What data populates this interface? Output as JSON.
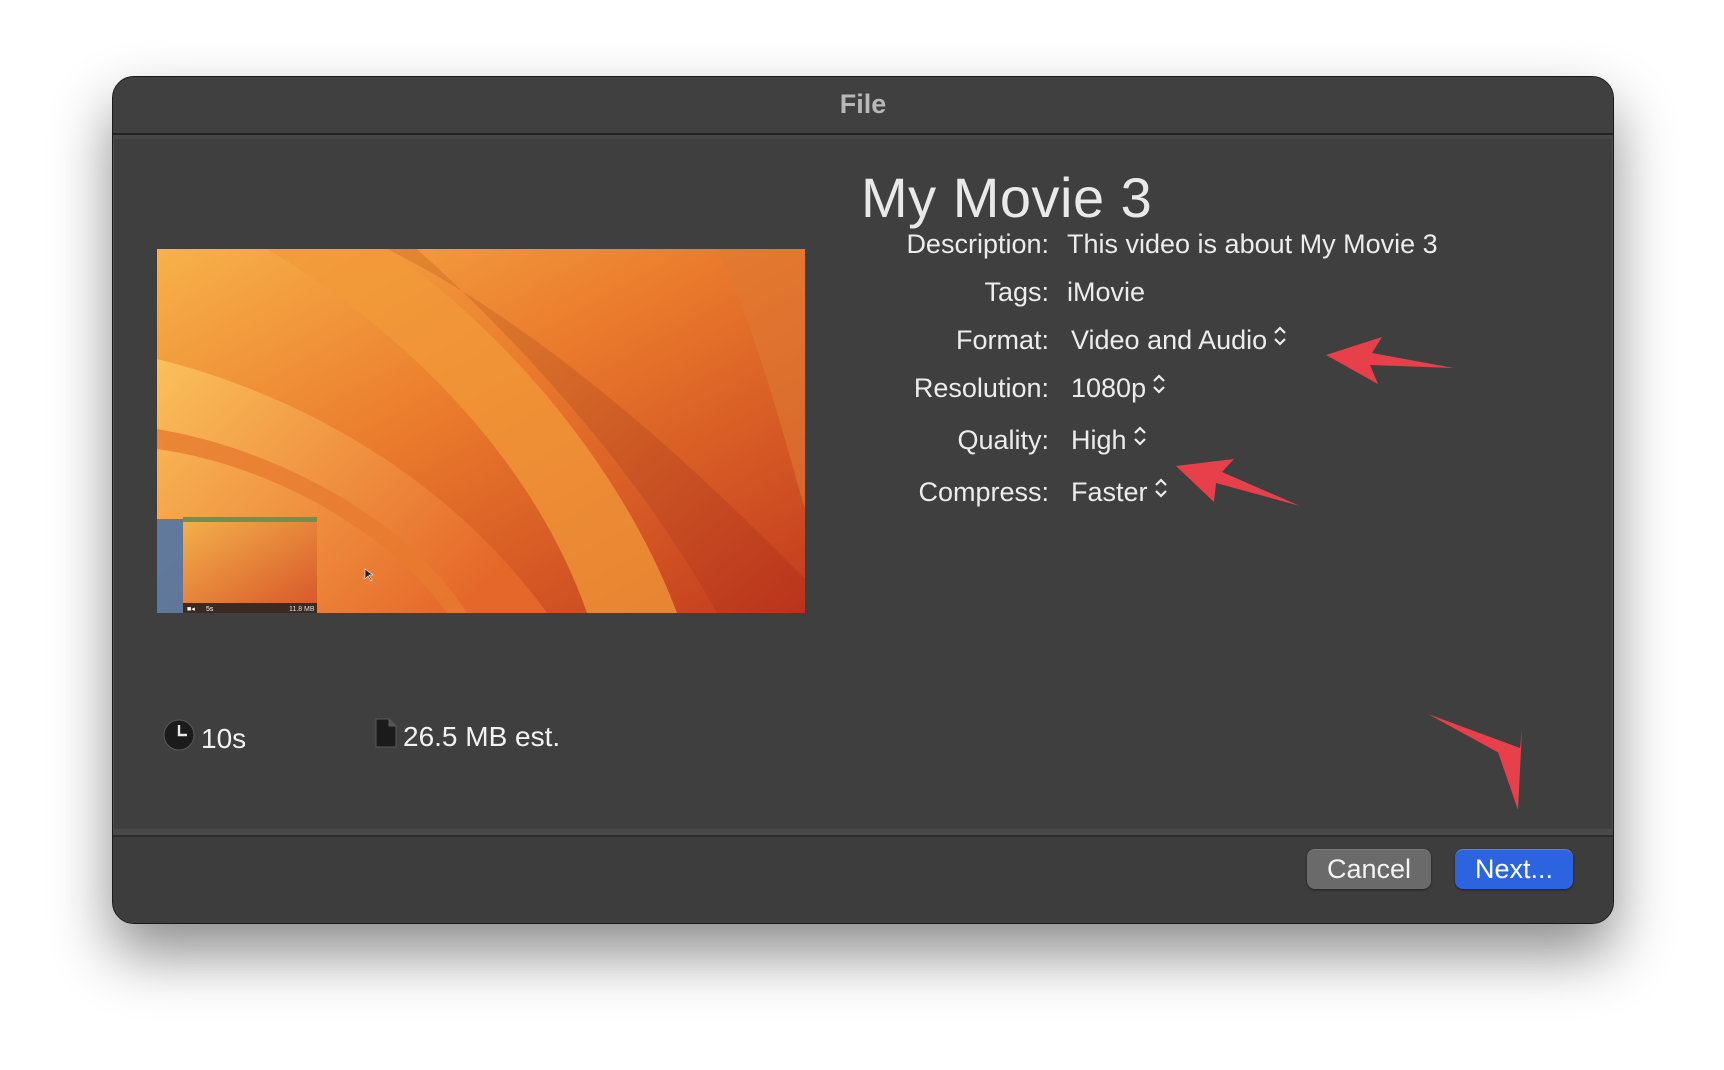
{
  "window": {
    "title": "File"
  },
  "movie": {
    "title": "My Movie 3"
  },
  "fields": {
    "description_label": "Description:",
    "description_value": "This video is about My Movie 3",
    "tags_label": "Tags:",
    "tags_value": "iMovie",
    "format_label": "Format:",
    "format_value": "Video and Audio",
    "resolution_label": "Resolution:",
    "resolution_value": "1080p",
    "quality_label": "Quality:",
    "quality_value": "High",
    "compress_label": "Compress:",
    "compress_value": "Faster"
  },
  "preview": {
    "thumb_duration": "5s",
    "thumb_size": "11.8 MB"
  },
  "stats": {
    "duration": "10s",
    "size": "26.5 MB est."
  },
  "buttons": {
    "cancel": "Cancel",
    "next": "Next..."
  },
  "colors": {
    "dialog_bg": "#3f3f3f",
    "accent": "#2c63df",
    "annotation_arrow": "#e8404a"
  },
  "icons": {
    "duration": "clock-icon",
    "size": "document-icon",
    "popup": "chevron-up-down-icon"
  }
}
